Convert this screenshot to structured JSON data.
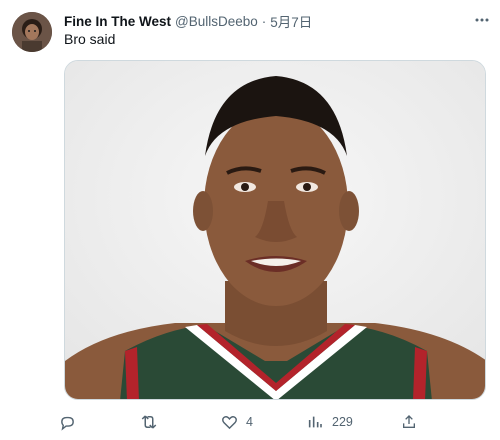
{
  "tweet": {
    "author_name": "Fine In The West",
    "handle": "@BullsDeebo",
    "separator": "·",
    "date": "5月7日",
    "text": "Bro said"
  },
  "actions": {
    "reply_count": "",
    "retweet_count": "",
    "like_count": "4",
    "views_count": "229",
    "share_count": ""
  },
  "icons": {
    "more": "more-dots-icon",
    "reply": "reply-icon",
    "retweet": "retweet-icon",
    "like": "heart-icon",
    "views": "views-chart-icon",
    "share": "share-icon"
  },
  "colors": {
    "text_primary": "#0f1419",
    "text_secondary": "#536471",
    "border": "#cfd9de",
    "jersey_green": "#2a4a36",
    "jersey_trim_red": "#b3232b"
  }
}
